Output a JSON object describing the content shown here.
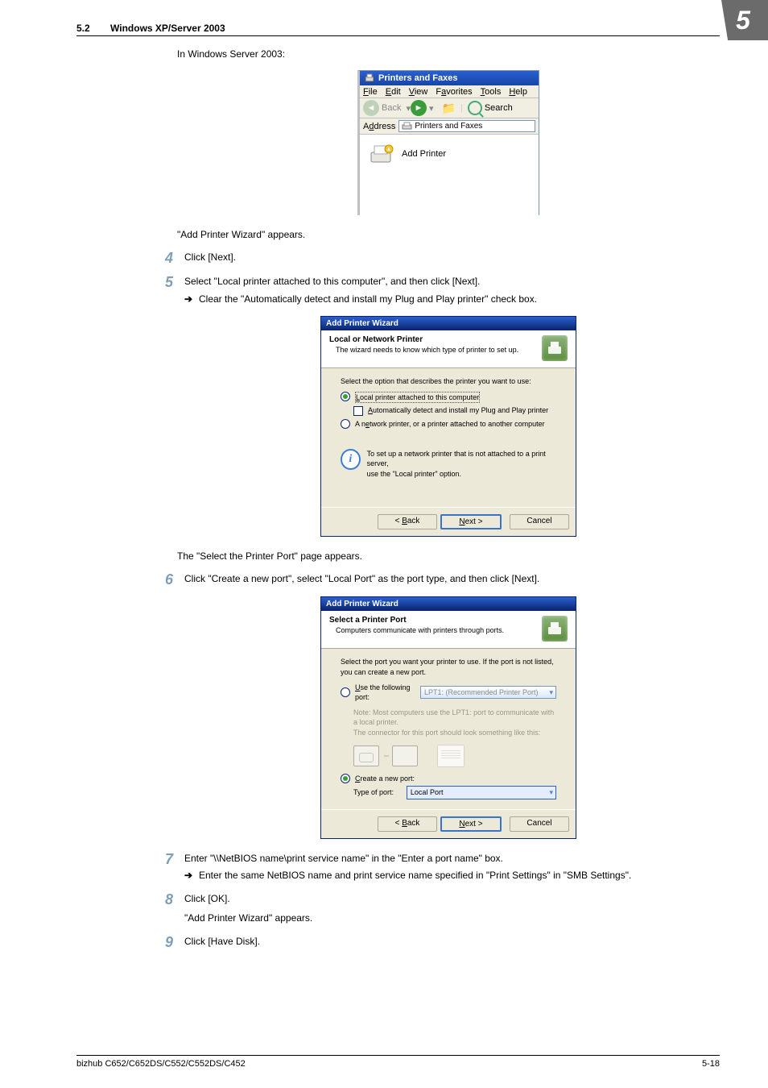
{
  "header": {
    "section_number": "5.2",
    "section_title": "Windows XP/Server 2003",
    "badge": "5"
  },
  "intro": {
    "line1": "In Windows Server 2003:"
  },
  "pf_window": {
    "title": "Printers and Faxes",
    "menu": {
      "file": "File",
      "edit": "Edit",
      "view": "View",
      "fav": "Favorites",
      "tools": "Tools",
      "help": "Help"
    },
    "toolbar": {
      "back": "Back",
      "search": "Search"
    },
    "address_label": "Address",
    "address_value": "Printers and Faxes",
    "body_item": "Add Printer"
  },
  "post_pf": {
    "line": "\"Add Printer Wizard\" appears."
  },
  "step4": {
    "num": "4",
    "text": "Click [Next]."
  },
  "step5": {
    "num": "5",
    "text": "Select \"Local printer attached to this computer\", and then click [Next].",
    "sub": "Clear the \"Automatically detect and install my Plug and Play printer\" check box."
  },
  "wiz1": {
    "title": "Add Printer Wizard",
    "head_title": "Local or Network Printer",
    "head_sub": "The wizard needs to know which type of printer to set up.",
    "body_intro": "Select the option that describes the printer you want to use:",
    "opt1": "Local printer attached to this computer",
    "chk1": "Automatically detect and install my Plug and Play printer",
    "opt2": "A network printer, or a printer attached to another computer",
    "info1": "To set up a network printer that is not attached to a print server,",
    "info2": "use the \"Local printer\" option.",
    "btn_back": "< Back",
    "btn_next": "Next >",
    "btn_cancel": "Cancel"
  },
  "post_wiz1": {
    "line": "The \"Select the Printer Port\" page appears."
  },
  "step6": {
    "num": "6",
    "text": "Click \"Create a new port\", select \"Local Port\" as the port type, and then click [Next]."
  },
  "wiz2": {
    "title": "Add Printer Wizard",
    "head_title": "Select a Printer Port",
    "head_sub": "Computers communicate with printers through ports.",
    "body_intro": "Select the port you want your printer to use. If the port is not listed, you can create a new port.",
    "opt1": "Use the following port:",
    "opt1_val": "LPT1: (Recommended Printer Port)",
    "note1": "Note: Most computers use the LPT1: port to communicate with a local printer.",
    "note2": "The connector for this port should look something like this:",
    "opt2": "Create a new port:",
    "type_label": "Type of port:",
    "type_val": "Local Port",
    "btn_back": "< Back",
    "btn_next": "Next >",
    "btn_cancel": "Cancel"
  },
  "step7": {
    "num": "7",
    "text": "Enter \"\\\\NetBIOS name\\print service name\" in the \"Enter a port name\" box.",
    "sub": "Enter the same NetBIOS name and print service name specified in \"Print Settings\" in \"SMB Settings\"."
  },
  "step8": {
    "num": "8",
    "text": "Click [OK].",
    "after": "\"Add Printer Wizard\" appears."
  },
  "step9": {
    "num": "9",
    "text": "Click [Have Disk]."
  },
  "footer": {
    "left": "bizhub C652/C652DS/C552/C552DS/C452",
    "right": "5-18"
  }
}
